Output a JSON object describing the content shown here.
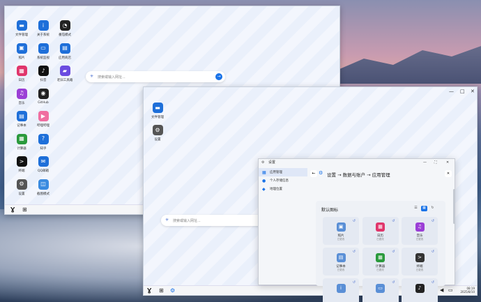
{
  "window1": {
    "icons": [
      {
        "label": "文件管理",
        "icon": "folder-icon",
        "color": "#1e6fd9",
        "glyph": "▬"
      },
      {
        "label": "关于系统",
        "icon": "info-icon",
        "color": "#1e6fd9",
        "glyph": "i"
      },
      {
        "label": "番茄模式",
        "icon": "clock-icon",
        "color": "#222222",
        "glyph": "◔"
      },
      {
        "label": "照片",
        "icon": "photo-icon",
        "color": "#1e6fd9",
        "glyph": "▣"
      },
      {
        "label": "系统监视",
        "icon": "monitor-icon",
        "color": "#1e6fd9",
        "glyph": "▭"
      },
      {
        "label": "应用商店",
        "icon": "store-icon",
        "color": "#1e6fd9",
        "glyph": "▤"
      },
      {
        "label": "日历",
        "icon": "calendar-icon",
        "color": "#e0356b",
        "glyph": "▦"
      },
      {
        "label": "抖音",
        "icon": "tiktok-icon",
        "color": "#111111",
        "glyph": "♪"
      },
      {
        "label": "老旧工具箱",
        "icon": "toolbox-icon",
        "color": "#6a4be0",
        "glyph": "▰"
      },
      {
        "label": "音乐",
        "icon": "music-icon",
        "color": "#9b3fd6",
        "glyph": "♫"
      },
      {
        "label": "GitHub",
        "icon": "github-icon",
        "color": "#222222",
        "glyph": "◉"
      },
      {
        "label": "",
        "icon": "",
        "color": "",
        "glyph": ""
      },
      {
        "label": "记事本",
        "icon": "notepad-icon",
        "color": "#1e6fd9",
        "glyph": "▤"
      },
      {
        "label": "哔哩哔哩",
        "icon": "bilibili-icon",
        "color": "#f06ea0",
        "glyph": "▶"
      },
      {
        "label": "",
        "icon": "",
        "color": "",
        "glyph": ""
      },
      {
        "label": "计算器",
        "icon": "calculator-icon",
        "color": "#2a9a3c",
        "glyph": "▦"
      },
      {
        "label": "知乎",
        "icon": "zhihu-icon",
        "color": "#1e6fd9",
        "glyph": "?"
      },
      {
        "label": "",
        "icon": "",
        "color": "",
        "glyph": ""
      },
      {
        "label": "终端",
        "icon": "terminal-icon",
        "color": "#111111",
        "glyph": ">"
      },
      {
        "label": "QQ邮箱",
        "icon": "mail-icon",
        "color": "#1e6fd9",
        "glyph": "✉"
      },
      {
        "label": "",
        "icon": "",
        "color": "",
        "glyph": ""
      },
      {
        "label": "设置",
        "icon": "gear-icon",
        "color": "#555555",
        "glyph": "⚙"
      },
      {
        "label": "截图模式",
        "icon": "screenshot-icon",
        "color": "#3a8be0",
        "glyph": "◫"
      }
    ],
    "search_placeholder": "搜索或输入网址..."
  },
  "window2": {
    "icons": [
      {
        "label": "文件管理",
        "icon": "folder-icon",
        "color": "#1e6fd9",
        "glyph": "▬"
      },
      {
        "label": "设置",
        "icon": "gear-icon",
        "color": "#555555",
        "glyph": "⚙"
      }
    ],
    "search_placeholder": "搜索或输入网址..."
  },
  "settings": {
    "title": "设置",
    "breadcrumb": "设置 → 数据与账户 → 应用管理",
    "sidebar": [
      {
        "label": "应用管理",
        "icon": "grid-icon",
        "glyph": "▦",
        "active": true
      },
      {
        "label": "个人存储信息",
        "icon": "user-icon",
        "glyph": "●",
        "active": false
      },
      {
        "label": "地理位置",
        "icon": "location-icon",
        "glyph": "◆",
        "active": false
      }
    ],
    "section_title": "默认图标",
    "apps": [
      {
        "name": "照片",
        "status": "已更改",
        "color": "#5a8fd6",
        "glyph": "▣"
      },
      {
        "name": "日历",
        "status": "已更改",
        "color": "#e0356b",
        "glyph": "▦"
      },
      {
        "name": "音乐",
        "status": "已更改",
        "color": "#9b3fd6",
        "glyph": "♫"
      },
      {
        "name": "记事本",
        "status": "已更改",
        "color": "#5a8fd6",
        "glyph": "▤"
      },
      {
        "name": "计算器",
        "status": "已更改",
        "color": "#2a9a3c",
        "glyph": "▦"
      },
      {
        "name": "终端",
        "status": "已更改",
        "color": "#333333",
        "glyph": ">"
      },
      {
        "name": "",
        "status": "",
        "color": "#5a8fd6",
        "glyph": "i"
      },
      {
        "name": "",
        "status": "",
        "color": "#5a8fd6",
        "glyph": "▭"
      },
      {
        "name": "",
        "status": "",
        "color": "#222222",
        "glyph": "♪"
      }
    ]
  },
  "tray": {
    "time": "08:19",
    "date": "2025/8/10"
  }
}
